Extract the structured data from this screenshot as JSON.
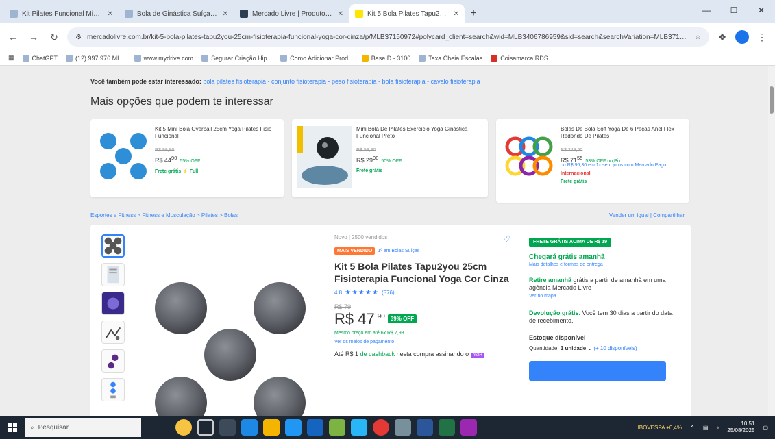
{
  "browser": {
    "tabs": [
      {
        "label": "Kit Pilates Funcional Mini Ban...",
        "active": false
      },
      {
        "label": "Bola de Ginástica Suíça Pilates Y...",
        "active": false
      },
      {
        "label": "Mercado Livre | Produtos Ort...",
        "active": false
      },
      {
        "label": "Kit 5 Bola Pilates Tapu2you 25...",
        "active": true
      }
    ],
    "new_tab": "+",
    "window_controls": {
      "minimize": "—",
      "maximize": "☐",
      "close": "✕"
    },
    "url": "mercadolivre.com.br/kit-5-bola-pilates-tapu2you-25cm-fisioterapia-funcional-yoga-cor-cinza/p/MLB37150972#polycard_client=search&wid=MLB3406786959&sid=search&searchVariation=MLB37150972&position=1",
    "bookmarks": [
      "ChatGPT",
      "(12) 997 976 ML...",
      "www.mydrive.com",
      "Segurar Criação Hip...",
      "Como Adicionar Prod...",
      "Base D - 3100",
      "Taxa Cheia Escalas",
      "Coisamarca RDS..."
    ]
  },
  "page": {
    "related": {
      "lead": "Você também pode estar interessado:",
      "links": "bola pilates fisioterapia - conjunto fisioterapia - peso fisioterapia - bola fisioterapia - cavalo fisioterapia"
    },
    "section_title": "Mais opções que podem te interessar",
    "related_cards": [
      {
        "title": "Kit 5 Mini Bola Overball 25cm Yoga Pilates Fisio Funcional",
        "old_price": "R$ 99,90",
        "price": "R$ 44",
        "price_cents": "90",
        "discount": "55% OFF",
        "shipping": "Frete grátis ⚡ Full",
        "extra": "",
        "extra2": "",
        "extra3": ""
      },
      {
        "title": "Mini Bola De Pilates Exercício Yoga Ginástica Funcional Preto",
        "old_price": "R$ 59,90",
        "price": "R$ 29",
        "price_cents": "90",
        "discount": "50% OFF",
        "shipping": "Frete grátis",
        "extra": "",
        "extra2": "",
        "extra3": ""
      },
      {
        "title": "Bolas De Bola Soft Yoga De 6 Peças Anel Flex Redondo De Pilates",
        "old_price": "R$ 249,50",
        "price": "R$ 71",
        "price_cents": "55",
        "discount": "53% OFF no Pix",
        "shipping": "",
        "extra": "ou R$ 96,30 em 1x sem juros com Mercado Pago",
        "extra2": "Internacional",
        "extra3": "Frete grátis"
      }
    ],
    "breadcrumbs": "Esportes e Fitness > Fitness e Musculação > Pilates > Bolas",
    "crumb_right": "Vender um igual | Compartilhar",
    "product": {
      "condition": "Novo | 2500 vendidos",
      "badge_orange": "MAIS VENDIDO",
      "badge_link": "1º em Bolas Suíças",
      "title": "Kit 5 Bola Pilates Tapu2you 25cm Fisioterapia Funcional Yoga Cor Cinza",
      "rating_score": "4.8",
      "stars": "★★★★★",
      "rating_count": "(576)",
      "old_price": "R$ 79",
      "price": "R$ 47",
      "price_cents": "90",
      "discount": "39% OFF",
      "installments": "Mesmo preço em até 6x R$ 7,98",
      "payment_link": "Ver os meios de pagamento",
      "cashback_lead": "Até R$ 1",
      "cashback_green": "de cashback",
      "cashback_rest": "nesta compra assinando o",
      "cashback_tag": "meli+"
    },
    "buybox": {
      "full_badge": "FRETE GRÁTIS ACIMA DE R$ 19",
      "arrival": "Chegará grátis amanhã",
      "arrival_sub": "Mais detalhes e formas de entrega",
      "pickup_green": "Retire amanhã",
      "pickup_rest": "grátis a partir de amanhã em uma agência Mercado Livre",
      "pickup_link": "Ver no mapa",
      "return_green": "Devolução grátis.",
      "return_rest": "Você tem 30 dias a partir do data de recebimento.",
      "stock": "Estoque disponível",
      "qty_label": "Quantidade:",
      "qty_value": "1 unidade",
      "qty_avail": "(+ 10 disponíveis)"
    }
  },
  "taskbar": {
    "search_placeholder": "Pesquisar",
    "tray_indicator": "IBOVESPA +0,4%",
    "time": "10:51",
    "date": "25/08/2025"
  },
  "colors": {
    "accent_blue": "#3483fa",
    "green": "#00a650",
    "orange": "#ff7733",
    "taskbar": "#1d2733"
  }
}
